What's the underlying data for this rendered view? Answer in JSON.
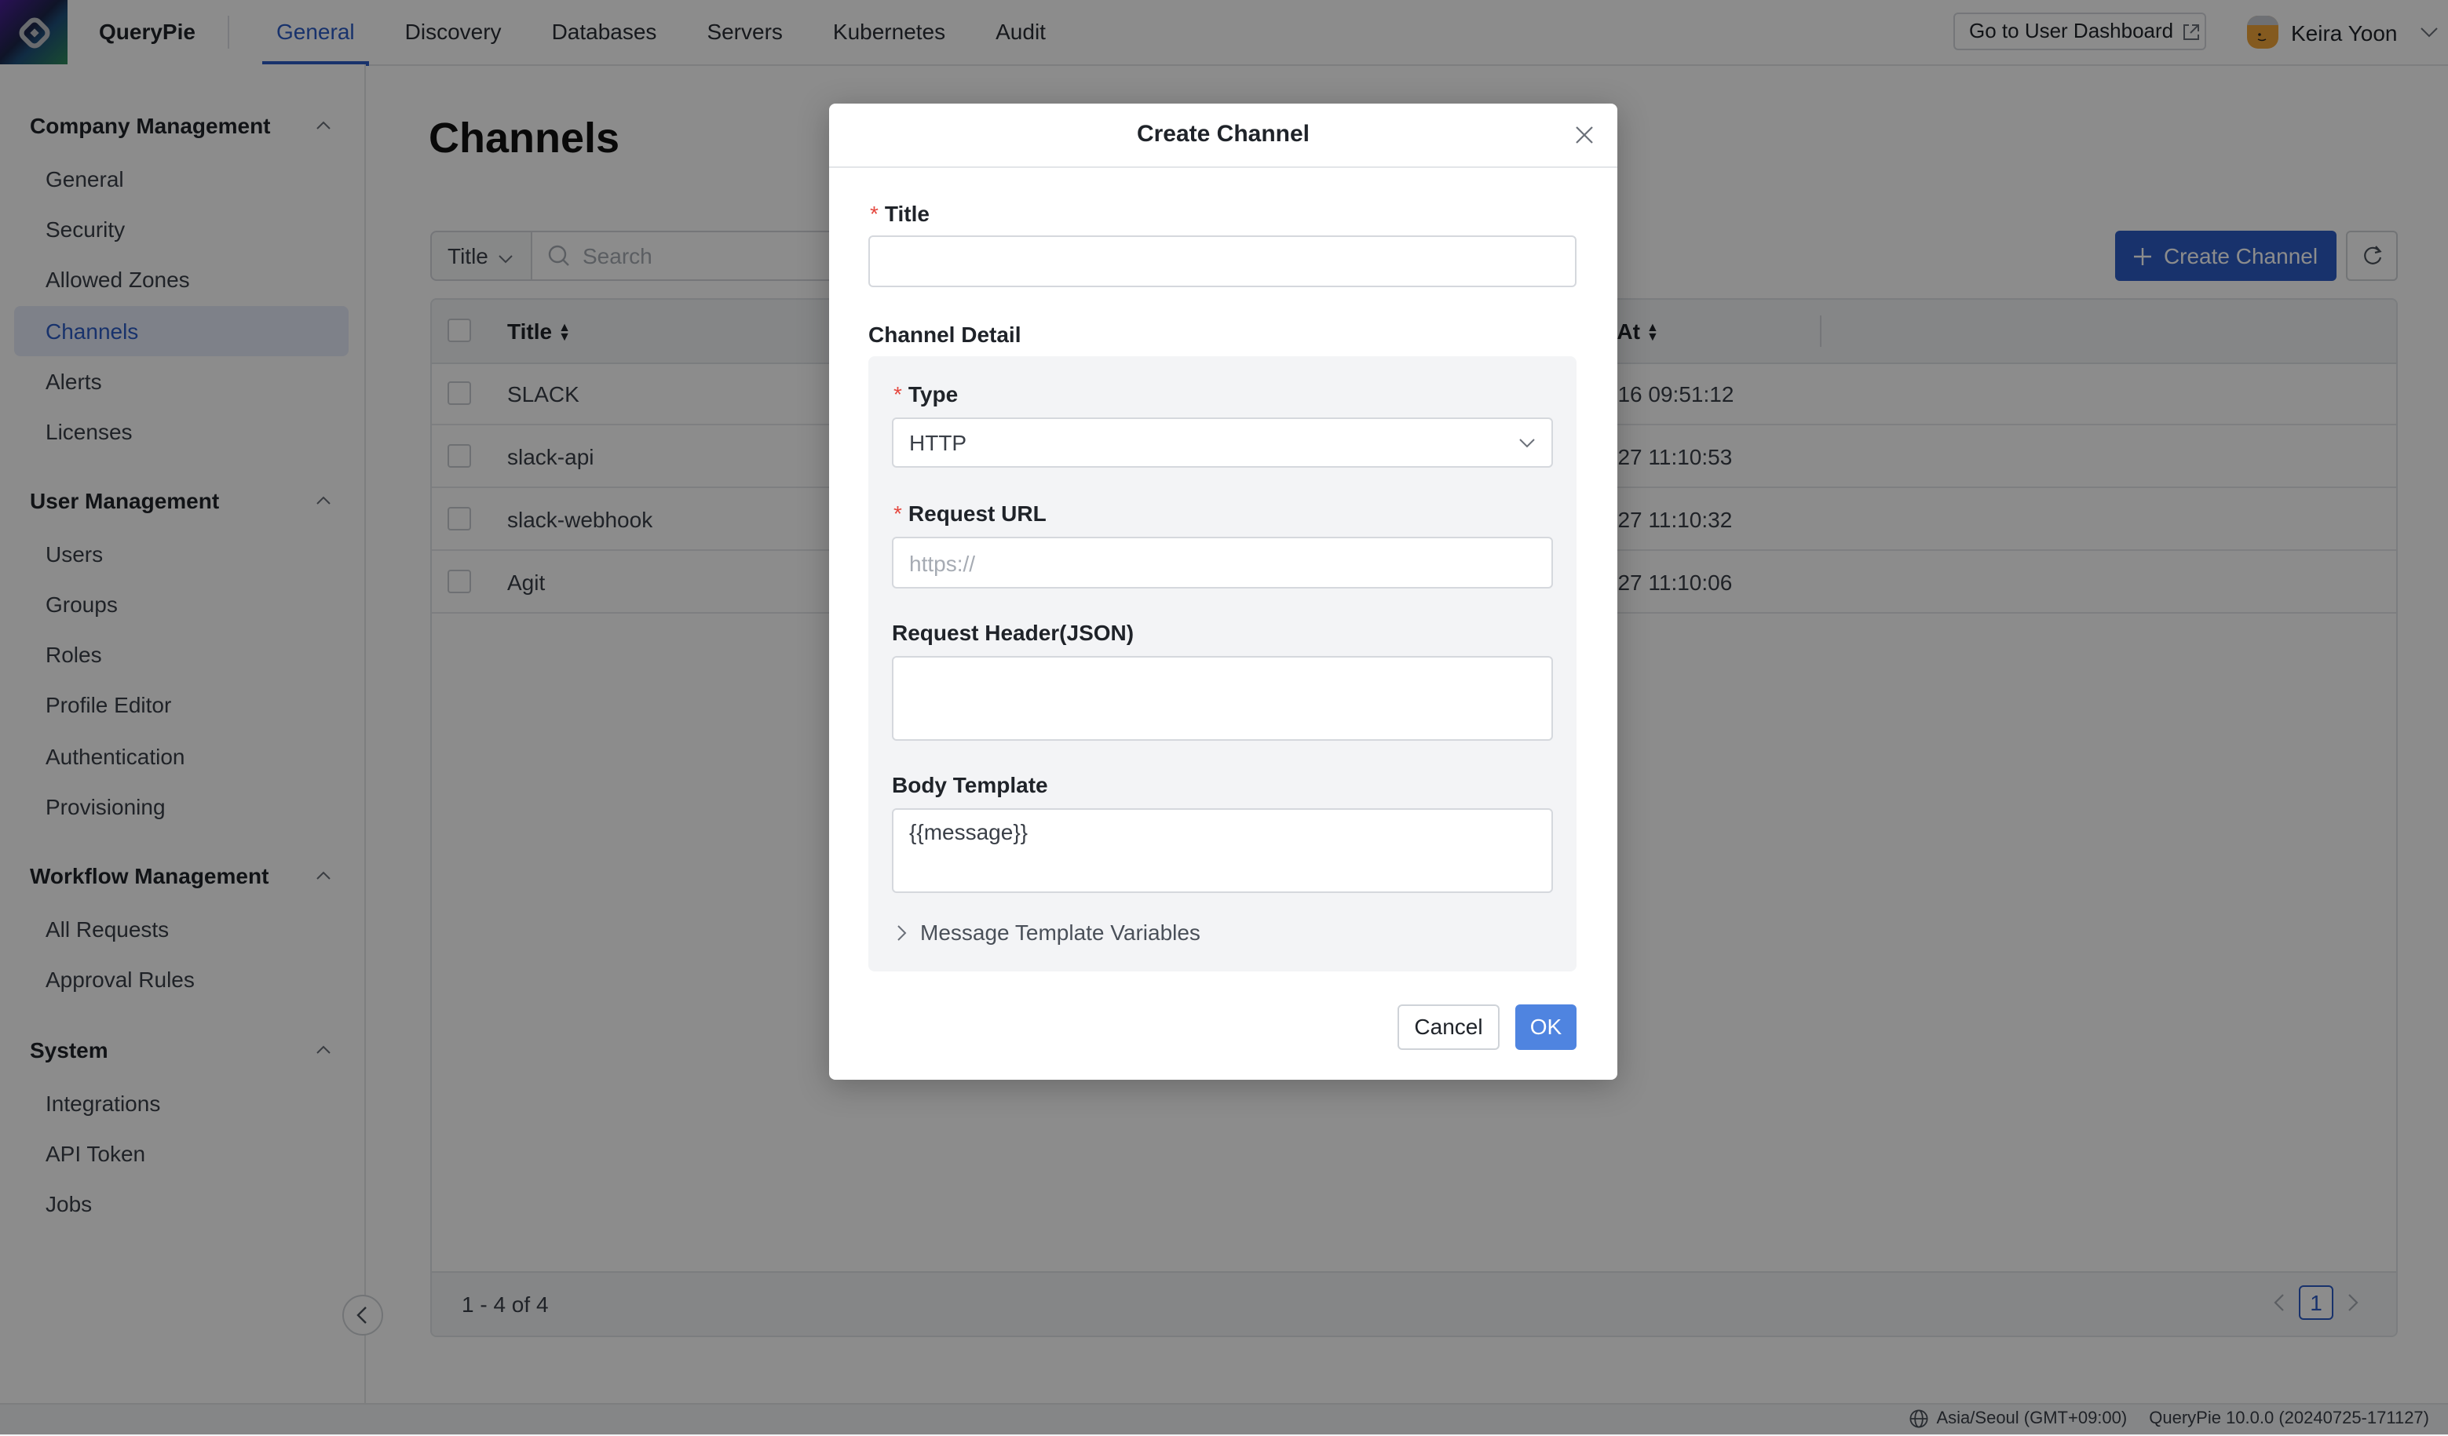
{
  "header": {
    "brand": "QueryPie",
    "nav": [
      {
        "label": "General",
        "active": true
      },
      {
        "label": "Discovery",
        "active": false
      },
      {
        "label": "Databases",
        "active": false
      },
      {
        "label": "Servers",
        "active": false
      },
      {
        "label": "Kubernetes",
        "active": false
      },
      {
        "label": "Audit",
        "active": false
      }
    ],
    "dashboard_button": "Go to User Dashboard",
    "user_name": "Keira Yoon"
  },
  "sidebar": {
    "sections": [
      {
        "title": "Company Management",
        "items": [
          "General",
          "Security",
          "Allowed Zones",
          "Channels",
          "Alerts",
          "Licenses"
        ]
      },
      {
        "title": "User Management",
        "items": [
          "Users",
          "Groups",
          "Roles",
          "Profile Editor",
          "Authentication",
          "Provisioning"
        ]
      },
      {
        "title": "Workflow Management",
        "items": [
          "All Requests",
          "Approval Rules"
        ]
      },
      {
        "title": "System",
        "items": [
          "Integrations",
          "API Token",
          "Jobs"
        ]
      }
    ],
    "active_item": "Channels"
  },
  "main": {
    "page_title": "Channels",
    "filter_field": "Title",
    "search_placeholder": "Search",
    "create_button": "Create Channel",
    "table": {
      "columns": [
        "Title",
        "ed At"
      ],
      "rows": [
        {
          "title": "SLACK",
          "date": "07-16 09:51:12"
        },
        {
          "title": "slack-api",
          "date": "06-27 11:10:53"
        },
        {
          "title": "slack-webhook",
          "date": "06-27 11:10:32"
        },
        {
          "title": "Agit",
          "date": "06-27 11:10:06"
        }
      ],
      "count_text": "1 - 4 of 4",
      "current_page": "1"
    }
  },
  "status_bar": {
    "timezone": "Asia/Seoul (GMT+09:00)",
    "version": "QueryPie 10.0.0 (20240725-171127)"
  },
  "modal": {
    "title": "Create Channel",
    "title_label": "Title",
    "title_value": "",
    "channel_detail_label": "Channel Detail",
    "type_label": "Type",
    "type_value": "HTTP",
    "request_url_label": "Request URL",
    "request_url_placeholder": "https://",
    "request_header_label": "Request Header(JSON)",
    "request_header_value": "",
    "body_template_label": "Body Template",
    "body_template_value": "{{message}}",
    "template_vars_label": "Message Template Variables",
    "cancel_label": "Cancel",
    "ok_label": "OK"
  },
  "colors": {
    "accent": "#2c5cc5",
    "ok_button": "#4f84e0",
    "required": "#e5483f"
  }
}
